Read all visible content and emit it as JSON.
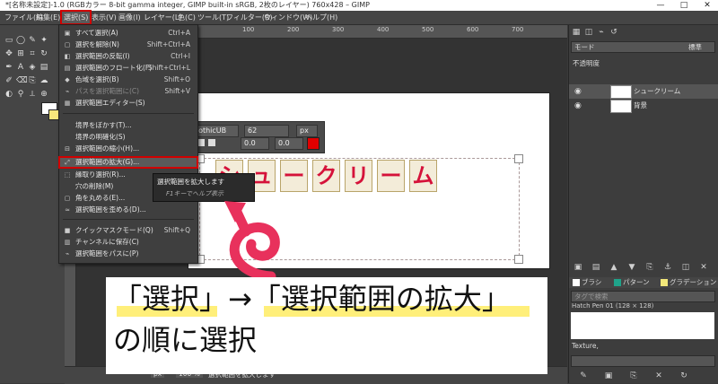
{
  "window": {
    "title": "*[名称未設定]-1.0 (RGBカラー 8-bit gamma integer, GIMP built-in sRGB, 2枚のレイヤー) 760x428 – GIMP",
    "minimize": "—",
    "maximize": "□",
    "close": "✕"
  },
  "menubar": [
    "ファイル(F)",
    "編集(E)",
    "選択(S)",
    "表示(V)",
    "画像(I)",
    "レイヤー(L)",
    "色(C)",
    "ツール(T)",
    "フィルター(R)",
    "ウィンドウ(W)",
    "ヘルプ(H)"
  ],
  "select_menu": {
    "items": [
      {
        "label": "すべて選択(A)",
        "shortcut": "Ctrl+A",
        "icon": "select-all-icon"
      },
      {
        "label": "選択を解除(N)",
        "shortcut": "Shift+Ctrl+A",
        "icon": "select-none-icon"
      },
      {
        "label": "選択範囲の反転(I)",
        "shortcut": "Ctrl+I",
        "icon": "invert-icon"
      },
      {
        "label": "選択範囲のフロート化(F)",
        "shortcut": "Shift+Ctrl+L",
        "icon": "float-icon"
      },
      {
        "label": "色域を選択(B)",
        "shortcut": "Shift+O",
        "icon": "color-select-icon"
      },
      {
        "label": "パスを選択範囲に(C)",
        "shortcut": "Shift+V",
        "icon": "path-icon",
        "disabled": true
      },
      {
        "label": "選択範囲エディター(S)",
        "shortcut": "",
        "icon": "editor-icon"
      },
      {
        "label": "境界をぼかす(T)...",
        "shortcut": "",
        "icon": ""
      },
      {
        "label": "境界の明確化(S)",
        "shortcut": "",
        "icon": ""
      },
      {
        "label": "選択範囲の縮小(H)...",
        "shortcut": "",
        "icon": "shrink-icon"
      },
      {
        "label": "選択範囲の拡大(G)...",
        "shortcut": "",
        "icon": "grow-icon",
        "highlighted": true
      },
      {
        "label": "縁取り選択(R)...",
        "shortcut": "",
        "icon": "border-icon"
      },
      {
        "label": "穴の削除(M)",
        "shortcut": "",
        "icon": ""
      },
      {
        "label": "角を丸める(E)...",
        "shortcut": "",
        "icon": "round-icon"
      },
      {
        "label": "選択範囲を歪める(D)...",
        "shortcut": "",
        "icon": "distort-icon"
      },
      {
        "label": "クイックマスクモード(Q)",
        "shortcut": "Shift+Q",
        "icon": "quickmask-icon"
      },
      {
        "label": "チャンネルに保存(C)",
        "shortcut": "",
        "icon": "channel-icon"
      },
      {
        "label": "選択範囲をパスに(P)",
        "shortcut": "",
        "icon": "to-path-icon"
      }
    ]
  },
  "tooltip": {
    "text": "選択範囲を拡大します",
    "help": "F1キーでヘルプ表示"
  },
  "text_toolbar": {
    "font": "gothicUB",
    "size": "62",
    "unit": "px",
    "offset1": "0.0",
    "offset2": "0.0",
    "color": "#e00000"
  },
  "canvas_text": [
    "シ",
    "ュ",
    "ー",
    "ク",
    "リ",
    "ー",
    "ム"
  ],
  "ruler_marks": [
    "100",
    "200",
    "300",
    "400",
    "500",
    "600",
    "700"
  ],
  "layers_panel": {
    "mode": "モード",
    "mode_value": "標準",
    "opacity": "不透明度",
    "layers": [
      {
        "name": "シュークリーム",
        "visible": true
      },
      {
        "name": "背景",
        "visible": true
      }
    ]
  },
  "brush_panel": {
    "tabs": [
      "ブラシ",
      "パターン",
      "グラデーション"
    ],
    "filter_placeholder": "タグで検索",
    "brush_name": "Hatch Pen 01 (128 × 128)",
    "tag_text": "Texture,"
  },
  "statusbar": {
    "unit": "px",
    "zoom": "100 %",
    "message": "選択範囲を拡大します"
  },
  "annotation": {
    "line1": "「選択」→「選択範囲の拡大」",
    "line2": "の順に選択"
  },
  "colors": {
    "accent_red": "#d00000",
    "text_red": "#d5123a",
    "highlight_yellow": "#ffef7a",
    "arrow_pink": "#e8315c"
  }
}
